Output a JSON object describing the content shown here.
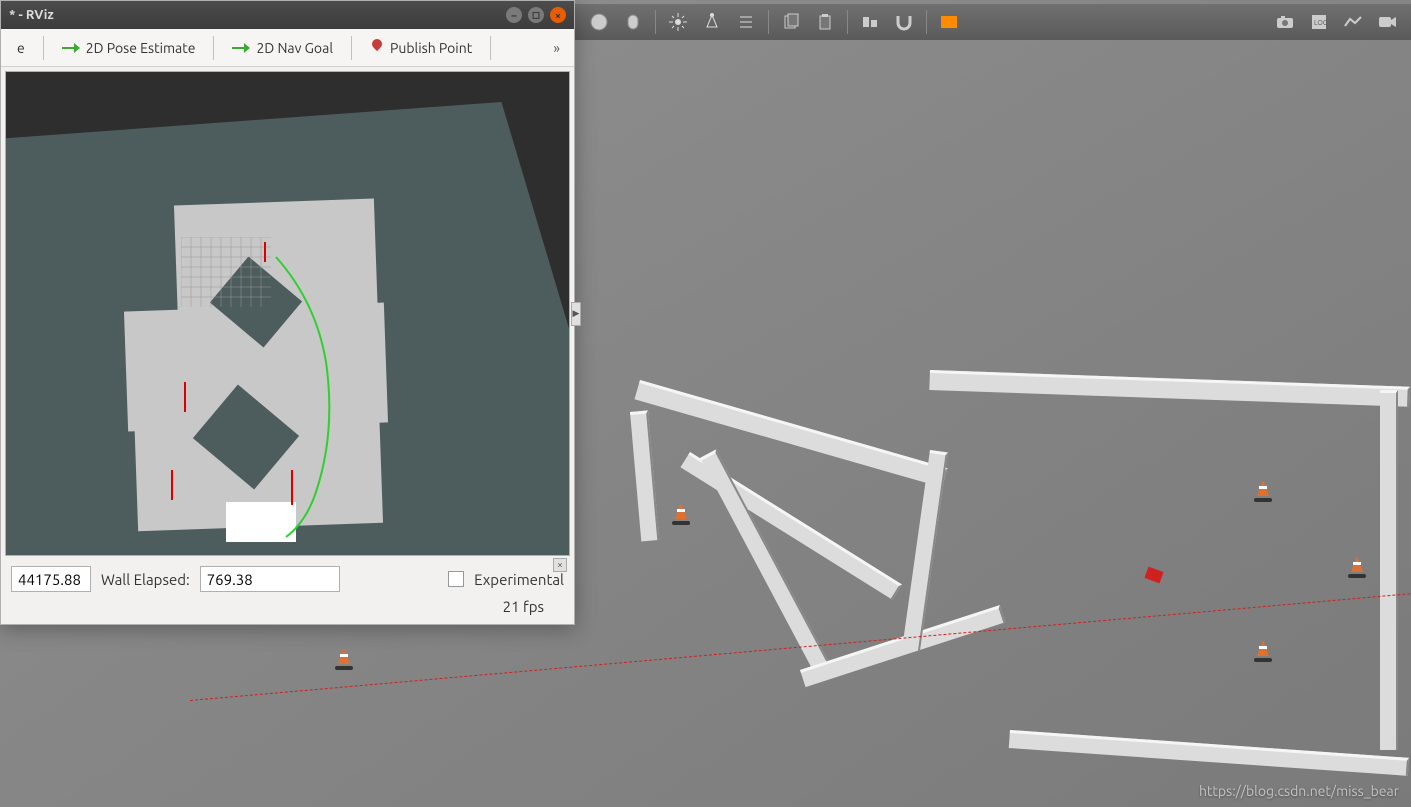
{
  "rviz": {
    "title": "* - RViz",
    "tools": {
      "cut_label": "e",
      "pose_estimate": "2D Pose Estimate",
      "nav_goal": "2D Nav Goal",
      "publish_point": "Publish Point",
      "more": "»"
    },
    "status": {
      "cut_value": "44175.88",
      "wall_elapsed_label": "Wall Elapsed:",
      "wall_elapsed_value": "769.38",
      "experimental_label": "Experimental",
      "fps": "21 fps"
    }
  },
  "gazebo": {
    "toolbar_icons": [
      "sphere-icon",
      "cylinder-icon",
      "light-point-icon",
      "light-spot-icon",
      "light-directional-icon",
      "copy-icon",
      "paste-icon",
      "align-icon",
      "snap-icon",
      "box-orange-icon"
    ],
    "right_icons": [
      "camera-icon",
      "log-icon",
      "plot-icon",
      "record-icon"
    ]
  },
  "watermark": "https://blog.csdn.net/miss_bear"
}
